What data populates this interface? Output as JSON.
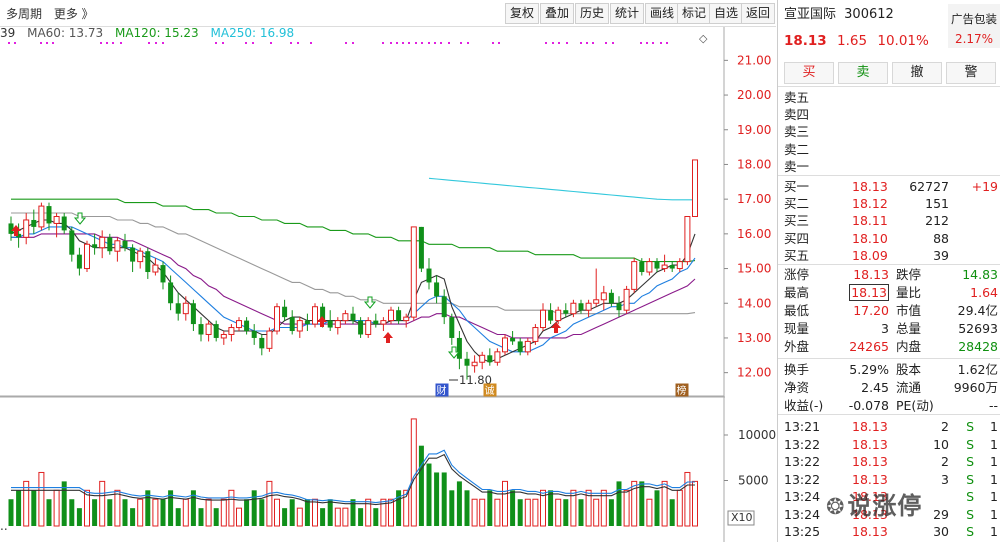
{
  "toolbar": {
    "period_label": "多周期",
    "more_label": "更多 》",
    "buttons": [
      "复权",
      "叠加",
      "历史",
      "统计",
      "画线",
      "标记",
      "自选",
      "返回"
    ]
  },
  "ma_legend": [
    {
      "label": "39",
      "color": "#333333"
    },
    {
      "label": "MA60: 13.73",
      "color": "#555555"
    },
    {
      "label": "MA120: 15.23",
      "color": "#1a9a1a"
    },
    {
      "label": "MA250: 16.98",
      "color": "#22c0d8"
    }
  ],
  "chart_data": {
    "type": "candlestick",
    "price_axis": {
      "min": 11.5,
      "max": 21.5,
      "ticks": [
        "21.00",
        "20.00",
        "19.00",
        "18.00",
        "17.00",
        "16.00",
        "15.00",
        "14.00",
        "13.00",
        "12.00"
      ]
    },
    "volume_axis": {
      "ticks": [
        "10000",
        "5000"
      ],
      "unit_label": "X10"
    },
    "low_annotation": "11.80",
    "markers": [
      "财",
      "诚",
      "榜"
    ],
    "candles": [
      [
        16.3,
        16.5,
        15.8,
        16.0
      ],
      [
        16.0,
        16.3,
        15.6,
        15.9
      ],
      [
        15.9,
        16.6,
        15.7,
        16.4
      ],
      [
        16.4,
        16.7,
        16.0,
        16.2
      ],
      [
        16.2,
        16.9,
        16.1,
        16.8
      ],
      [
        16.8,
        16.9,
        16.1,
        16.3
      ],
      [
        16.3,
        16.6,
        15.9,
        16.5
      ],
      [
        16.5,
        16.6,
        16.0,
        16.1
      ],
      [
        16.1,
        16.2,
        15.2,
        15.4
      ],
      [
        15.4,
        15.6,
        14.8,
        15.0
      ],
      [
        15.0,
        15.8,
        14.9,
        15.7
      ],
      [
        15.7,
        16.0,
        15.4,
        15.6
      ],
      [
        15.6,
        16.1,
        15.3,
        15.9
      ],
      [
        15.9,
        16.0,
        15.4,
        15.5
      ],
      [
        15.5,
        15.9,
        15.2,
        15.8
      ],
      [
        15.8,
        16.0,
        15.5,
        15.6
      ],
      [
        15.6,
        15.7,
        14.9,
        15.2
      ],
      [
        15.2,
        15.6,
        15.0,
        15.5
      ],
      [
        15.5,
        15.6,
        14.7,
        14.9
      ],
      [
        14.9,
        15.3,
        14.8,
        15.1
      ],
      [
        15.1,
        15.2,
        14.4,
        14.6
      ],
      [
        14.6,
        14.8,
        13.8,
        14.0
      ],
      [
        14.0,
        14.3,
        13.5,
        13.7
      ],
      [
        13.7,
        14.2,
        13.5,
        14.0
      ],
      [
        14.0,
        14.1,
        13.2,
        13.4
      ],
      [
        13.4,
        13.6,
        12.9,
        13.1
      ],
      [
        13.1,
        13.5,
        12.9,
        13.4
      ],
      [
        13.4,
        13.5,
        12.9,
        13.0
      ],
      [
        13.0,
        13.2,
        12.8,
        13.1
      ],
      [
        13.1,
        13.4,
        12.9,
        13.3
      ],
      [
        13.3,
        13.6,
        13.2,
        13.5
      ],
      [
        13.5,
        13.6,
        13.1,
        13.2
      ],
      [
        13.2,
        13.4,
        12.8,
        13.0
      ],
      [
        13.0,
        13.1,
        12.5,
        12.7
      ],
      [
        12.7,
        13.3,
        12.6,
        13.2
      ],
      [
        13.2,
        14.0,
        13.1,
        13.9
      ],
      [
        13.9,
        14.1,
        13.5,
        13.6
      ],
      [
        13.6,
        13.8,
        13.1,
        13.2
      ],
      [
        13.2,
        13.6,
        13.0,
        13.5
      ],
      [
        13.5,
        13.7,
        13.2,
        13.4
      ],
      [
        13.4,
        14.0,
        13.3,
        13.9
      ],
      [
        13.9,
        14.0,
        13.3,
        13.5
      ],
      [
        13.5,
        13.8,
        13.2,
        13.3
      ],
      [
        13.3,
        13.6,
        13.1,
        13.5
      ],
      [
        13.5,
        13.8,
        13.4,
        13.7
      ],
      [
        13.7,
        13.9,
        13.4,
        13.5
      ],
      [
        13.5,
        13.6,
        13.0,
        13.1
      ],
      [
        13.1,
        13.6,
        13.0,
        13.5
      ],
      [
        13.5,
        13.7,
        13.3,
        13.4
      ],
      [
        13.4,
        13.6,
        13.2,
        13.5
      ],
      [
        13.5,
        13.9,
        13.4,
        13.8
      ],
      [
        13.8,
        13.9,
        13.4,
        13.5
      ],
      [
        13.5,
        13.7,
        13.3,
        13.6
      ],
      [
        13.6,
        16.2,
        13.5,
        16.2
      ],
      [
        16.2,
        16.2,
        14.9,
        15.0
      ],
      [
        15.0,
        15.3,
        14.4,
        14.6
      ],
      [
        14.6,
        14.8,
        14.0,
        14.2
      ],
      [
        14.2,
        14.4,
        13.4,
        13.6
      ],
      [
        13.6,
        13.7,
        12.8,
        13.0
      ],
      [
        13.0,
        13.2,
        12.1,
        12.4
      ],
      [
        12.4,
        12.6,
        11.8,
        12.2
      ],
      [
        12.2,
        12.5,
        12.0,
        12.3
      ],
      [
        12.3,
        12.6,
        12.1,
        12.5
      ],
      [
        12.5,
        12.7,
        12.2,
        12.3
      ],
      [
        12.3,
        12.7,
        12.2,
        12.6
      ],
      [
        12.6,
        13.1,
        12.5,
        13.0
      ],
      [
        13.0,
        13.2,
        12.8,
        12.9
      ],
      [
        12.9,
        13.0,
        12.5,
        12.6
      ],
      [
        12.6,
        13.0,
        12.5,
        12.9
      ],
      [
        12.9,
        13.4,
        12.8,
        13.3
      ],
      [
        13.3,
        14.0,
        13.2,
        13.8
      ],
      [
        13.8,
        14.0,
        13.4,
        13.5
      ],
      [
        13.5,
        13.9,
        13.4,
        13.8
      ],
      [
        13.8,
        14.0,
        13.6,
        13.7
      ],
      [
        13.7,
        14.1,
        13.6,
        14.0
      ],
      [
        14.0,
        14.1,
        13.7,
        13.8
      ],
      [
        13.8,
        14.1,
        13.6,
        14.0
      ],
      [
        14.0,
        15.0,
        13.9,
        14.1
      ],
      [
        14.1,
        14.5,
        13.8,
        14.3
      ],
      [
        14.3,
        14.4,
        13.9,
        14.0
      ],
      [
        14.0,
        14.2,
        13.6,
        13.8
      ],
      [
        13.8,
        14.5,
        13.7,
        14.4
      ],
      [
        14.4,
        15.3,
        14.3,
        15.2
      ],
      [
        15.2,
        15.3,
        14.8,
        14.9
      ],
      [
        14.9,
        15.3,
        14.8,
        15.2
      ],
      [
        15.2,
        15.3,
        14.9,
        15.0
      ],
      [
        15.0,
        15.4,
        14.9,
        15.1
      ],
      [
        15.1,
        15.2,
        14.9,
        15.0
      ],
      [
        15.0,
        15.3,
        14.9,
        15.2
      ],
      [
        15.2,
        16.5,
        15.1,
        16.5
      ],
      [
        16.5,
        18.13,
        16.5,
        18.13
      ]
    ],
    "volumes": [
      3,
      4,
      5,
      4,
      6,
      3,
      4,
      5,
      3,
      2,
      4,
      3,
      5,
      3,
      4,
      3,
      2,
      3,
      4,
      3,
      3,
      4,
      2,
      3,
      4,
      2,
      3,
      2,
      3,
      4,
      2,
      3,
      4,
      3,
      5,
      3,
      2,
      3,
      2,
      3,
      3,
      2,
      3,
      2,
      2,
      3,
      2,
      3,
      2,
      3,
      3,
      4,
      4,
      12,
      9,
      7,
      6,
      6,
      4,
      5,
      4,
      3,
      3,
      4,
      3,
      5,
      4,
      3,
      3,
      3,
      4,
      4,
      3,
      3,
      4,
      3,
      4,
      3,
      4,
      3,
      5,
      4,
      5,
      5,
      3,
      4,
      5,
      3,
      4,
      6,
      5
    ],
    "ma5": [
      16.0,
      16.1,
      16.2,
      16.3,
      16.4,
      16.4,
      16.3,
      16.3,
      16.1,
      15.8,
      15.7,
      15.6,
      15.6,
      15.6,
      15.6,
      15.6,
      15.5,
      15.4,
      15.3,
      15.1,
      14.9,
      14.6,
      14.3,
      14.1,
      13.9,
      13.7,
      13.5,
      13.3,
      13.2,
      13.2,
      13.2,
      13.2,
      13.2,
      13.1,
      13.1,
      13.3,
      13.5,
      13.6,
      13.6,
      13.5,
      13.5,
      13.5,
      13.5,
      13.5,
      13.5,
      13.5,
      13.4,
      13.4,
      13.4,
      13.4,
      13.5,
      13.5,
      13.5,
      14.1,
      14.6,
      14.7,
      14.8,
      14.7,
      13.9,
      13.4,
      12.9,
      12.6,
      12.4,
      12.3,
      12.4,
      12.5,
      12.6,
      12.7,
      12.8,
      12.9,
      13.2,
      13.3,
      13.5,
      13.6,
      13.7,
      13.8,
      13.8,
      13.9,
      14.0,
      14.0,
      14.0,
      14.1,
      14.3,
      14.5,
      14.7,
      14.9,
      15.0,
      15.1,
      15.1,
      15.4,
      16.0
    ],
    "ma10": [
      15.9,
      15.9,
      16.0,
      16.0,
      16.1,
      16.2,
      16.2,
      16.2,
      16.2,
      16.1,
      16.0,
      15.9,
      15.8,
      15.7,
      15.7,
      15.6,
      15.6,
      15.5,
      15.4,
      15.3,
      15.2,
      15.0,
      14.8,
      14.6,
      14.4,
      14.2,
      14.0,
      13.8,
      13.6,
      13.5,
      13.4,
      13.3,
      13.2,
      13.2,
      13.2,
      13.3,
      13.3,
      13.3,
      13.3,
      13.4,
      13.4,
      13.4,
      13.5,
      13.5,
      13.5,
      13.5,
      13.5,
      13.5,
      13.4,
      13.4,
      13.5,
      13.5,
      13.5,
      13.7,
      13.9,
      14.1,
      14.2,
      14.2,
      14.0,
      13.8,
      13.5,
      13.3,
      13.1,
      12.9,
      12.8,
      12.7,
      12.6,
      12.6,
      12.6,
      12.7,
      12.8,
      13.0,
      13.1,
      13.2,
      13.4,
      13.5,
      13.6,
      13.7,
      13.8,
      13.9,
      13.9,
      14.0,
      14.0,
      14.2,
      14.3,
      14.5,
      14.6,
      14.7,
      14.9,
      15.0,
      15.3
    ],
    "ma20": [
      15.9,
      15.9,
      15.9,
      15.9,
      16.0,
      16.0,
      16.0,
      16.0,
      16.0,
      16.0,
      16.0,
      16.0,
      15.9,
      15.9,
      15.9,
      15.8,
      15.8,
      15.7,
      15.6,
      15.5,
      15.4,
      15.3,
      15.1,
      15.0,
      14.8,
      14.7,
      14.5,
      14.4,
      14.2,
      14.1,
      14.0,
      13.9,
      13.8,
      13.7,
      13.6,
      13.5,
      13.4,
      13.4,
      13.4,
      13.4,
      13.4,
      13.4,
      13.4,
      13.4,
      13.4,
      13.4,
      13.4,
      13.4,
      13.4,
      13.4,
      13.4,
      13.4,
      13.4,
      13.5,
      13.6,
      13.6,
      13.7,
      13.7,
      13.6,
      13.6,
      13.5,
      13.4,
      13.3,
      13.2,
      13.1,
      13.1,
      13.0,
      13.0,
      13.0,
      13.0,
      13.0,
      13.0,
      13.0,
      13.0,
      13.1,
      13.1,
      13.2,
      13.3,
      13.4,
      13.5,
      13.6,
      13.7,
      13.8,
      13.9,
      14.0,
      14.1,
      14.2,
      14.3,
      14.4,
      14.5,
      14.7
    ],
    "ma60": [
      16.6,
      16.6,
      16.6,
      16.6,
      16.6,
      16.6,
      16.6,
      16.6,
      16.6,
      16.5,
      16.5,
      16.5,
      16.5,
      16.5,
      16.4,
      16.4,
      16.4,
      16.3,
      16.3,
      16.2,
      16.2,
      16.1,
      16.0,
      16.0,
      15.9,
      15.8,
      15.7,
      15.6,
      15.5,
      15.4,
      15.3,
      15.2,
      15.1,
      15.0,
      14.9,
      14.8,
      14.7,
      14.6,
      14.6,
      14.5,
      14.4,
      14.4,
      14.3,
      14.3,
      14.2,
      14.2,
      14.1,
      14.1,
      14.1,
      14.0,
      14.0,
      14.0,
      14.0,
      14.0,
      14.0,
      14.0,
      14.0,
      14.0,
      14.0,
      13.9,
      13.9,
      13.9,
      13.9,
      13.9,
      13.9,
      13.8,
      13.8,
      13.8,
      13.8,
      13.8,
      13.8,
      13.8,
      13.7,
      13.7,
      13.7,
      13.7,
      13.7,
      13.7,
      13.7,
      13.7,
      13.7,
      13.7,
      13.7,
      13.7,
      13.7,
      13.7,
      13.7,
      13.7,
      13.7,
      13.7,
      13.73
    ],
    "ma120": [
      17.0,
      17.0,
      17.0,
      17.0,
      17.0,
      17.0,
      17.0,
      17.0,
      17.0,
      17.0,
      17.0,
      17.0,
      17.0,
      17.0,
      17.0,
      16.9,
      16.9,
      16.9,
      16.9,
      16.9,
      16.8,
      16.8,
      16.8,
      16.8,
      16.7,
      16.7,
      16.7,
      16.6,
      16.6,
      16.6,
      16.5,
      16.5,
      16.5,
      16.4,
      16.4,
      16.4,
      16.3,
      16.3,
      16.3,
      16.2,
      16.2,
      16.2,
      16.1,
      16.1,
      16.1,
      16.0,
      16.0,
      16.0,
      15.9,
      15.9,
      15.9,
      15.8,
      15.8,
      15.8,
      15.8,
      15.7,
      15.7,
      15.7,
      15.7,
      15.6,
      15.6,
      15.6,
      15.6,
      15.6,
      15.5,
      15.5,
      15.5,
      15.5,
      15.5,
      15.4,
      15.4,
      15.4,
      15.4,
      15.4,
      15.4,
      15.3,
      15.3,
      15.3,
      15.3,
      15.3,
      15.3,
      15.3,
      15.3,
      15.2,
      15.2,
      15.2,
      15.2,
      15.2,
      15.2,
      15.2,
      15.23
    ],
    "ma250": [
      null,
      null,
      null,
      null,
      null,
      null,
      null,
      null,
      null,
      null,
      null,
      null,
      null,
      null,
      null,
      null,
      null,
      null,
      null,
      null,
      null,
      null,
      null,
      null,
      null,
      null,
      null,
      null,
      null,
      null,
      null,
      null,
      null,
      null,
      null,
      null,
      null,
      null,
      null,
      null,
      null,
      null,
      null,
      null,
      null,
      null,
      null,
      null,
      null,
      null,
      null,
      null,
      null,
      null,
      null,
      17.6,
      17.58,
      17.56,
      17.54,
      17.52,
      17.5,
      17.48,
      17.46,
      17.44,
      17.42,
      17.4,
      17.38,
      17.36,
      17.34,
      17.32,
      17.3,
      17.28,
      17.26,
      17.24,
      17.22,
      17.2,
      17.18,
      17.16,
      17.14,
      17.12,
      17.1,
      17.08,
      17.06,
      17.04,
      17.02,
      17.0,
      16.99,
      16.98,
      16.98,
      16.98,
      16.98
    ],
    "vol_ma5": [
      4,
      4,
      4,
      4,
      4,
      4,
      4,
      4,
      4,
      4,
      3.5,
      3.4,
      3.4,
      3.5,
      3.6,
      3.4,
      3.2,
      3.1,
      3.2,
      3.1,
      3.0,
      3.2,
      3.1,
      3.0,
      3.2,
      3.0,
      2.9,
      2.9,
      2.9,
      3.0,
      2.9,
      2.9,
      3.0,
      3.1,
      3.4,
      3.5,
      3.3,
      3.2,
      3.0,
      2.7,
      2.7,
      2.6,
      2.7,
      2.6,
      2.5,
      2.5,
      2.5,
      2.5,
      2.4,
      2.5,
      2.6,
      3.0,
      3.3,
      5.2,
      6.4,
      7.6,
      7.6,
      8.0,
      6.4,
      5.6,
      5.0,
      4.4,
      3.8,
      3.8,
      3.6,
      3.6,
      3.8,
      3.8,
      3.6,
      3.6,
      3.4,
      3.6,
      3.6,
      3.4,
      3.4,
      3.6,
      3.4,
      3.4,
      3.4,
      3.4,
      3.8,
      3.8,
      4.2,
      4.4,
      4.4,
      4.2,
      4.4,
      4.0,
      4.0,
      4.6,
      4.6
    ]
  },
  "quote": {
    "name": "宣亚国际",
    "code": "300612",
    "price": "18.13",
    "change": "1.65",
    "change_pct": "10.01%",
    "ad_label": "广告包装",
    "ad_pct": "2.17%",
    "buy_btn": "买",
    "sell_btn": "卖",
    "cancel_btn": "撤",
    "alert_btn": "警"
  },
  "asks": [
    {
      "label": "卖五",
      "price": "",
      "vol": ""
    },
    {
      "label": "卖四",
      "price": "",
      "vol": ""
    },
    {
      "label": "卖三",
      "price": "",
      "vol": ""
    },
    {
      "label": "卖二",
      "price": "",
      "vol": ""
    },
    {
      "label": "卖一",
      "price": "",
      "vol": ""
    }
  ],
  "bids": [
    {
      "label": "买一",
      "price": "18.13",
      "vol": "62727",
      "chg": "+19"
    },
    {
      "label": "买二",
      "price": "18.12",
      "vol": "151",
      "chg": ""
    },
    {
      "label": "买三",
      "price": "18.11",
      "vol": "212",
      "chg": ""
    },
    {
      "label": "买四",
      "price": "18.10",
      "vol": "88",
      "chg": ""
    },
    {
      "label": "买五",
      "price": "18.09",
      "vol": "39",
      "chg": ""
    }
  ],
  "stats": [
    {
      "l1": "涨停",
      "v1": "18.13",
      "c1": "red",
      "l2": "跌停",
      "v2": "14.83",
      "c2": "green"
    },
    {
      "l1": "最高",
      "v1": "18.13",
      "c1": "red",
      "l2": "量比",
      "v2": "1.64",
      "c2": "red"
    },
    {
      "l1": "最低",
      "v1": "17.20",
      "c1": "red",
      "l2": "市值",
      "v2": "29.4亿",
      "c2": ""
    },
    {
      "l1": "现量",
      "v1": "3",
      "c1": "",
      "l2": "总量",
      "v2": "52693",
      "c2": ""
    },
    {
      "l1": "外盘",
      "v1": "24265",
      "c1": "red",
      "l2": "内盘",
      "v2": "28428",
      "c2": "green"
    }
  ],
  "stats2": [
    {
      "l1": "换手",
      "v1": "5.29%",
      "l2": "股本",
      "v2": "1.62亿"
    },
    {
      "l1": "净资",
      "v1": "2.45",
      "l2": "流通",
      "v2": "9960万"
    },
    {
      "l1": "收益(-)",
      "v1": "-0.078",
      "l2": "PE(动)",
      "v2": "--"
    }
  ],
  "ticks": [
    {
      "time": "13:21",
      "price": "18.13",
      "vol": "2",
      "side": "S",
      "n": "1"
    },
    {
      "time": "13:22",
      "price": "18.13",
      "vol": "10",
      "side": "S",
      "n": "1"
    },
    {
      "time": "13:22",
      "price": "18.13",
      "vol": "2",
      "side": "S",
      "n": "1"
    },
    {
      "time": "13:22",
      "price": "18.13",
      "vol": "3",
      "side": "S",
      "n": "1"
    },
    {
      "time": "13:24",
      "price": "18.13",
      "vol": "",
      "side": "S",
      "n": "1"
    },
    {
      "time": "13:24",
      "price": "18.13",
      "vol": "29",
      "side": "S",
      "n": "1"
    },
    {
      "time": "13:25",
      "price": "18.13",
      "vol": "30",
      "side": "S",
      "n": "1"
    }
  ],
  "watermark": "说涨停"
}
